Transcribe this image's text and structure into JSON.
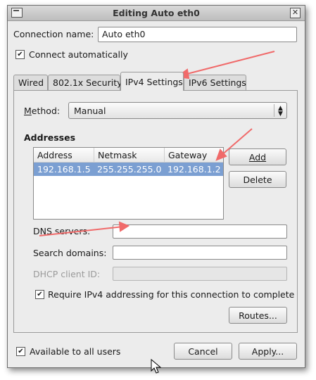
{
  "window": {
    "title": "Editing Auto eth0",
    "close_glyph": "✕"
  },
  "connection": {
    "name_label": "Connection name:",
    "name_value": "Auto eth0",
    "connect_auto_label": "Connect automatically",
    "connect_auto_checked": true
  },
  "tabs": [
    {
      "label": "Wired",
      "active": false
    },
    {
      "label": "802.1x Security",
      "active": false
    },
    {
      "label": "IPv4 Settings",
      "active": true
    },
    {
      "label": "IPv6 Settings",
      "active": false
    }
  ],
  "ipv4": {
    "method_label": "Method:",
    "method_value": "Manual",
    "addresses_heading": "Addresses",
    "columns": [
      "Address",
      "Netmask",
      "Gateway"
    ],
    "rows": [
      {
        "address": "192.168.1.5",
        "netmask": "255.255.255.0",
        "gateway": "192.168.1.2"
      }
    ],
    "add_label": "Add",
    "delete_label": "Delete",
    "dns_label": "DNS servers:",
    "dns_value": "",
    "search_label": "Search domains:",
    "search_value": "",
    "dhcp_label": "DHCP client ID:",
    "dhcp_value": "",
    "require_label": "Require IPv4 addressing for this connection to complete",
    "require_checked": true,
    "routes_label": "Routes..."
  },
  "footer": {
    "available_label": "Available to all users",
    "available_checked": true,
    "cancel_label": "Cancel",
    "apply_label": "Apply..."
  },
  "colors": {
    "annotation_arrow": "#f06a6a",
    "selection": "#7b9fd2"
  }
}
